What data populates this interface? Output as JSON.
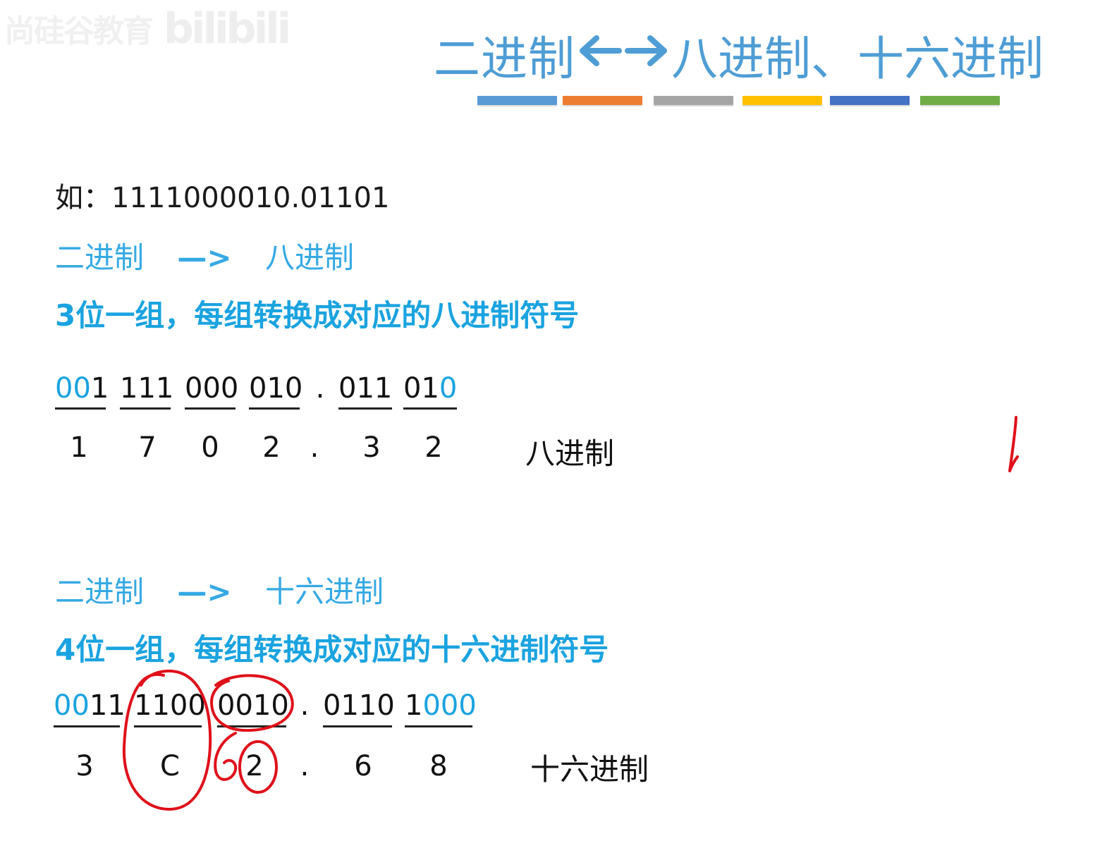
{
  "watermark": {
    "text": "尚硅谷教育",
    "logo": "bilibili"
  },
  "title": {
    "left": "二进制",
    "arrows": "←→",
    "right": "八进制、十六进制"
  },
  "title_bar_colors": [
    "#5b9bd5",
    "#ed7d31",
    "#a5a5a5",
    "#ffc000",
    "#4472c4",
    "#70ad47"
  ],
  "example": {
    "prefix": "如：",
    "number": "1111000010.01101"
  },
  "octal_section": {
    "heading_from": "二进制",
    "heading_arrow": "—>",
    "heading_to": "八进制",
    "description": "3位一组，每组转换成对应的八进制符号",
    "groups": [
      {
        "hi": "00",
        "rest": "1",
        "tail": ""
      },
      {
        "hi": "",
        "rest": "111",
        "tail": ""
      },
      {
        "hi": "",
        "rest": "000",
        "tail": ""
      },
      {
        "hi": "",
        "rest": "010",
        "tail": ""
      },
      {
        "hi": "",
        "rest": ".",
        "tail": ""
      },
      {
        "hi": "",
        "rest": "011",
        "tail": ""
      },
      {
        "hi": "",
        "rest": "01",
        "tail": "0"
      }
    ],
    "digits": [
      "1",
      "7",
      "0",
      "2",
      ".",
      "3",
      "2"
    ],
    "result_label": "八进制"
  },
  "hex_section": {
    "heading_from": "二进制",
    "heading_arrow": "—>",
    "heading_to": "十六进制",
    "description": "4位一组，每组转换成对应的十六进制符号",
    "groups": [
      {
        "hi": "00",
        "rest": "11",
        "tail": ""
      },
      {
        "hi": "",
        "rest": "1100",
        "tail": ""
      },
      {
        "hi": "",
        "rest": "0010",
        "tail": ""
      },
      {
        "hi": "",
        "rest": ".",
        "tail": ""
      },
      {
        "hi": "",
        "rest": "0110",
        "tail": ""
      },
      {
        "hi": "",
        "rest": "1",
        "tail": "000"
      }
    ],
    "digits": [
      "3",
      "C",
      "2",
      ".",
      "6",
      "8"
    ],
    "result_label": "十六进制"
  },
  "colors": {
    "title": "#4e9dd5",
    "accent": "#1aa3e0",
    "pen": "#e0101a"
  }
}
